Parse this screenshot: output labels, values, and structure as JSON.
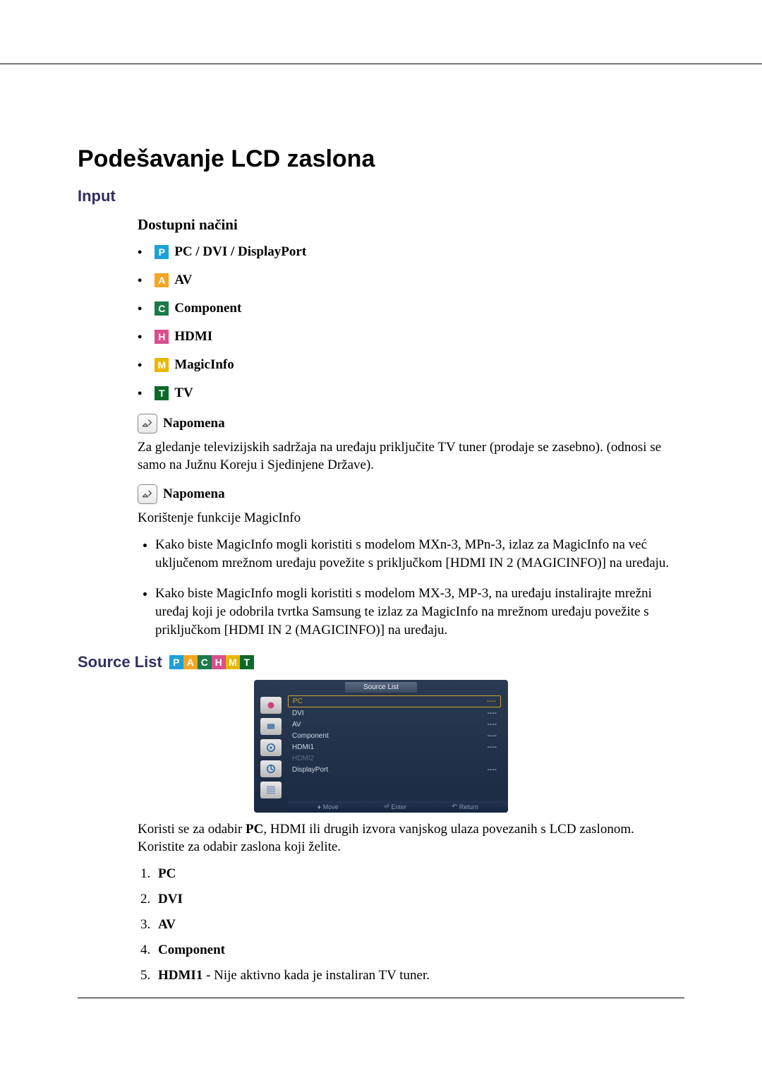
{
  "page_title": "Podešavanje LCD zaslona",
  "section_input": "Input",
  "section_modes": "Dostupni načini",
  "modes": {
    "pc": "PC / DVI / DisplayPort",
    "av": "AV",
    "component": "Component",
    "hdmi": "HDMI",
    "magicinfo": "MagicInfo",
    "tv": "TV"
  },
  "note_label": "Napomena",
  "note1_text": "Za gledanje televizijskih sadržaja na uređaju priključite TV tuner (prodaje se zasebno). (odnosi se samo na Južnu Koreju i Sjedinjene Države).",
  "note2_text": "Korištenje funkcije MagicInfo",
  "magicinfo_bullets": {
    "b1": "Kako biste MagicInfo mogli koristiti s modelom MXn-3, MPn-3, izlaz za MagicInfo na već uključenom mrežnom uređaju povežite s priključkom [HDMI IN 2 (MAGICINFO)] na uređaju.",
    "b2": "Kako biste MagicInfo mogli koristiti s modelom MX-3, MP-3, na uređaju instalirajte mrežni uređaj koji je odobrila tvrtka Samsung te izlaz za MagicInfo na mrežnom uređaju povežite s priključkom [HDMI IN 2 (MAGICINFO)] na uređaju."
  },
  "source_list_heading": "Source List",
  "osd": {
    "title": "Source List",
    "rows": {
      "pc": {
        "label": "PC",
        "val": "----"
      },
      "dvi": {
        "label": "DVI",
        "val": "----"
      },
      "av": {
        "label": "AV",
        "val": "----"
      },
      "component": {
        "label": "Component",
        "val": "----"
      },
      "hdmi1": {
        "label": "HDMI1",
        "val": "----"
      },
      "hdmi2": {
        "label": "HDMI2",
        "val": ""
      },
      "displayport": {
        "label": "DisplayPort",
        "val": "----"
      }
    },
    "footer": {
      "move": "Move",
      "enter": "Enter",
      "ret": "Return"
    }
  },
  "source_list_desc_prefix": "Koristi se za odabir ",
  "source_list_desc_bold": "PC",
  "source_list_desc_suffix": ", HDMI ili drugih izvora vanjskog ulaza povezanih s LCD zaslonom. Koristite za odabir zaslona koji želite.",
  "sources": {
    "s1": "PC",
    "s2": "DVI",
    "s3": "AV",
    "s4": "Component",
    "s5_bold": "HDMI1",
    "s5_rest": " - Nije aktivno kada je instaliran TV tuner."
  }
}
